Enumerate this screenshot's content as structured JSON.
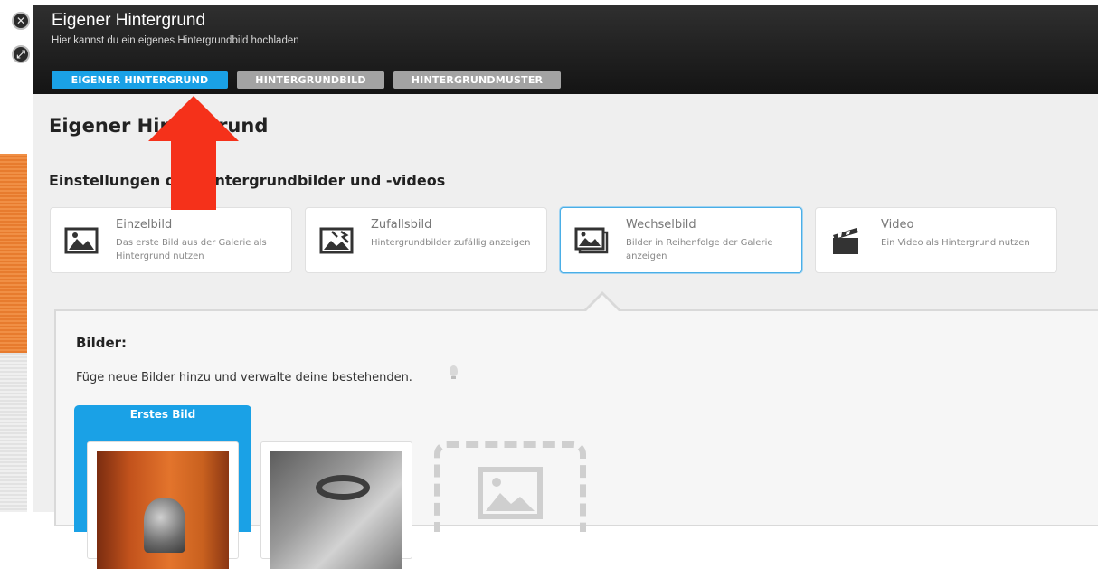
{
  "window": {
    "title": "Eigener Hintergrund",
    "subtitle": "Hier kannst du ein eigenes Hintergrundbild hochladen",
    "controls": [
      "close-icon",
      "resize-icon"
    ]
  },
  "tabs": [
    {
      "label": "EIGENER HINTERGRUND",
      "active": true
    },
    {
      "label": "HINTERGRUNDBILD",
      "active": false
    },
    {
      "label": "HINTERGRUNDMUSTER",
      "active": false
    }
  ],
  "page": {
    "title": "Eigener Hintergrund",
    "section_title": "Einstellungen der Hintergrundbilder und -videos"
  },
  "modes": [
    {
      "title": "Einzelbild",
      "description": "Das erste Bild aus der Galerie als Hintergrund nutzen",
      "icon": "single-image-icon",
      "selected": false
    },
    {
      "title": "Zufallsbild",
      "description": "Hintergrundbilder zufällig anzeigen",
      "icon": "random-image-icon",
      "selected": false
    },
    {
      "title": "Wechselbild",
      "description": "Bilder in Reihenfolge der Galerie anzeigen",
      "icon": "slideshow-icon",
      "selected": true
    },
    {
      "title": "Video",
      "description": "Ein Video als Hintergrund nutzen",
      "icon": "clapperboard-icon",
      "selected": false
    }
  ],
  "images_panel": {
    "title": "Bilder:",
    "description": "Füge neue Bilder hinzu und verwalte deine bestehenden.",
    "first_image_label": "Erstes Bild"
  },
  "colors": {
    "accent": "#1aa1e6",
    "header_bg": "#1f1f1f",
    "inactive_tab": "#a3a3a3",
    "annotation_arrow": "#f5311a"
  }
}
